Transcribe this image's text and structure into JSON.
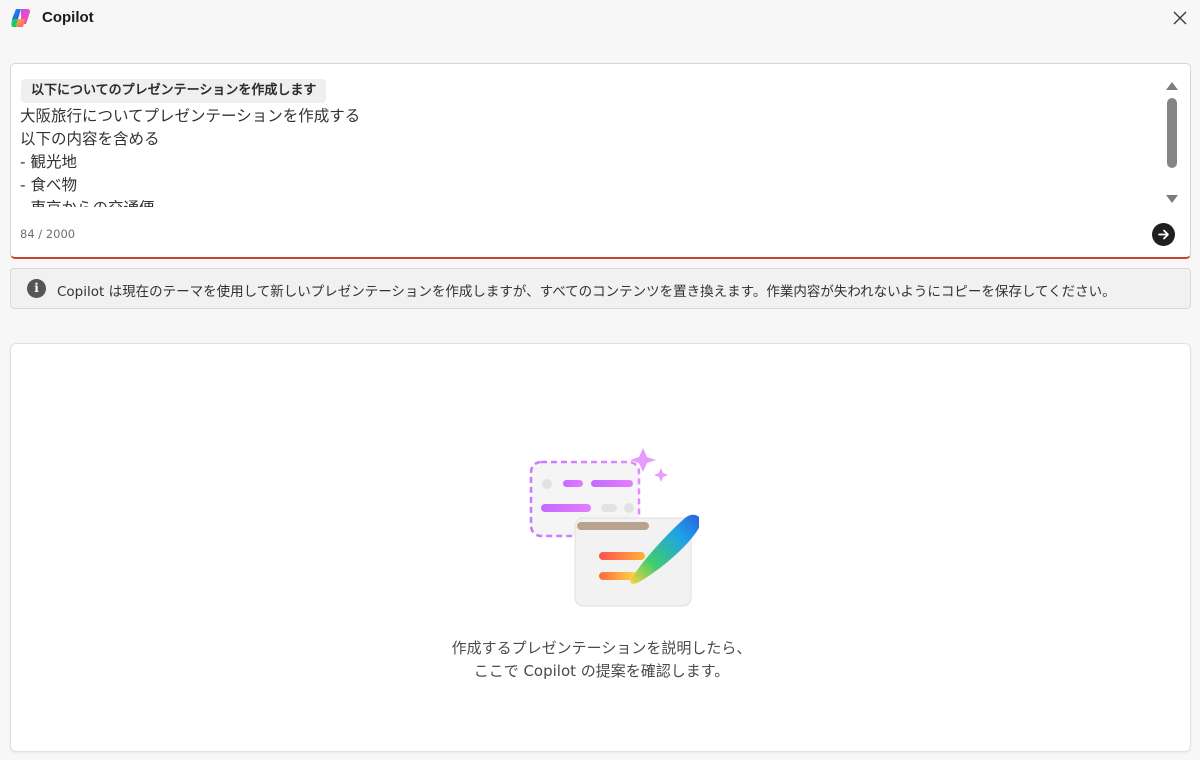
{
  "app": {
    "title": "Copilot",
    "logo_icon": "copilot-logo-icon",
    "close_icon": "close-icon"
  },
  "prompt": {
    "chip_label": "以下についてのプレゼンテーションを作成します",
    "text": "大阪旅行についてプレゼンテーションを作成する\n以下の内容を含める\n- 観光地\n- 食べ物\n- 東京からの交通便",
    "char_count": "84 / 2000",
    "send_icon": "arrow-right-icon",
    "accent_color": "#c4442f"
  },
  "info": {
    "icon": "info-icon",
    "text": "Copilot は現在のテーマを使用して新しいプレゼンテーションを作成しますが、すべてのコンテンツを置き換えます。作業内容が失われないようにコピーを保存してください。"
  },
  "empty_state": {
    "illustration": "presentation-pen-illustration",
    "line1": "作成するプレゼンテーションを説明したら、",
    "line2": "ここで Copilot の提案を確認します。"
  }
}
